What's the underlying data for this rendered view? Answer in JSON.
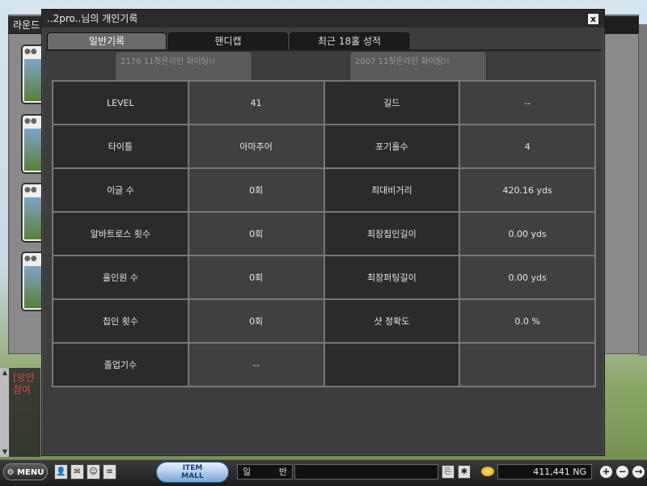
{
  "background": {
    "window_title": "라운드",
    "chat_lines": [
      "[방만",
      "참여"
    ]
  },
  "dialog": {
    "title": "..2pro..님의 개인기록",
    "close_label": "x",
    "tabs": [
      {
        "label": "일반기록",
        "active": true
      },
      {
        "label": "핸디캡",
        "active": false
      },
      {
        "label": "최근 18홀 성적",
        "active": false
      }
    ],
    "ghost_cards": [
      "2176 11첫온라인 화이팅!!",
      "2007 11첫온라인 화이팅!!"
    ],
    "stats": [
      {
        "label": "LEVEL",
        "value": "41",
        "label2": "길드",
        "value2": "--"
      },
      {
        "label": "타이틀",
        "value": "아마추어",
        "label2": "포기홀수",
        "value2": "4"
      },
      {
        "label": "이글 수",
        "value": "0회",
        "label2": "최대비거리",
        "value2": "420.16 yds"
      },
      {
        "label": "알바트로스 횟수",
        "value": "0회",
        "label2": "최장칩인길이",
        "value2": "0.00 yds"
      },
      {
        "label": "홀인원 수",
        "value": "0회",
        "label2": "최장퍼팅길이",
        "value2": "0.00 yds"
      },
      {
        "label": "칩인 횟수",
        "value": "0회",
        "label2": "샷 정확도",
        "value2": "0.0 %"
      },
      {
        "label": "졸업기수",
        "value": "--",
        "label2": "",
        "value2": ""
      }
    ]
  },
  "bottom_bar": {
    "menu_label": "MENU",
    "item_mall_line1": "ITEM",
    "item_mall_line2": "MALL",
    "chat_mode_left": "일",
    "chat_mode_right": "반",
    "chat_input_value": "",
    "money": "411,441 NG",
    "zoom_in": "+",
    "zoom_out": "−",
    "exit": "→"
  },
  "colors": {
    "dialog_bg": "#3d3d3d",
    "label_cell": "#2b2b2b",
    "value_cell": "#404040",
    "grid_line": "#777777",
    "active_tab": "#6a6a6a"
  }
}
